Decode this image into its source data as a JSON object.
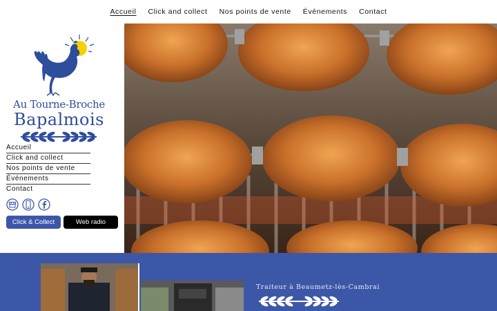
{
  "topnav": {
    "items": [
      {
        "label": "Accueil"
      },
      {
        "label": "Click and collect"
      },
      {
        "label": "Nos points de vente"
      },
      {
        "label": "Événements"
      },
      {
        "label": "Contact"
      }
    ]
  },
  "logo": {
    "line1": "Au Tourne-Broche",
    "line2": "Bapalmois"
  },
  "sidebar": {
    "items": [
      {
        "label": "Accueil"
      },
      {
        "label": "Click and collect"
      },
      {
        "label": "Nos points de vente"
      },
      {
        "label": "Événements"
      },
      {
        "label": "Contact"
      }
    ],
    "icons": [
      "shop-icon",
      "phone-icon",
      "facebook-icon"
    ],
    "buttons": {
      "click_collect": "Click & Collect",
      "web_radio": "Web radio"
    }
  },
  "band": {
    "tagline": "Traiteur à Beaumetz-lès-Cambrai"
  },
  "colors": {
    "brand_blue": "#3d57a8",
    "logo_blue": "#2e4d9d",
    "sun_yellow": "#f5d000"
  }
}
